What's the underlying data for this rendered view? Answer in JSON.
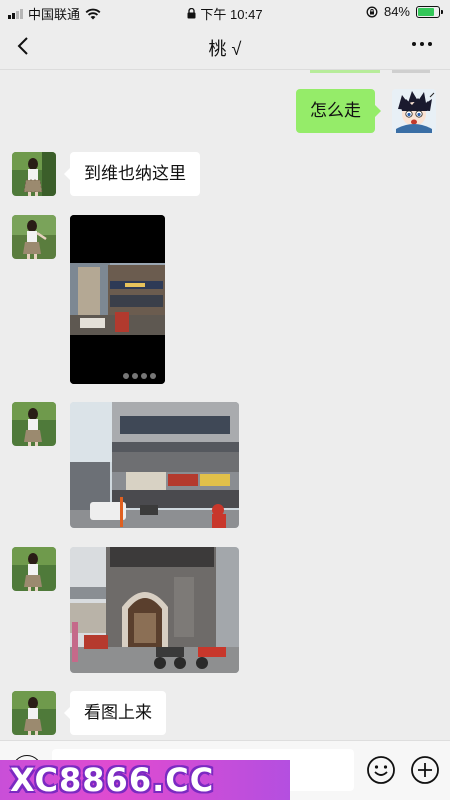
{
  "status_bar": {
    "carrier": "中国联通",
    "time": "下午 10:47",
    "battery_pct": "84%",
    "battery_level": 0.84
  },
  "header": {
    "title": "桃 √"
  },
  "messages": [
    {
      "side": "out",
      "type": "text",
      "text": "怎么走"
    },
    {
      "side": "in",
      "type": "text",
      "text": "到维也纳这里"
    },
    {
      "side": "in",
      "type": "video"
    },
    {
      "side": "in",
      "type": "image"
    },
    {
      "side": "in",
      "type": "image"
    },
    {
      "side": "in",
      "type": "text",
      "text": "看图上来"
    }
  ],
  "watermark": {
    "text": "XC8866.CC"
  },
  "colors": {
    "background": "#ededed",
    "outgoing_bubble": "#95ec69",
    "incoming_bubble": "#ffffff",
    "watermark": "#d24fd8"
  },
  "icons": [
    "back-arrow-icon",
    "more-dots-icon",
    "voice-icon",
    "emoji-icon",
    "plus-icon",
    "wifi-icon",
    "lock-icon",
    "rotation-lock-icon"
  ]
}
